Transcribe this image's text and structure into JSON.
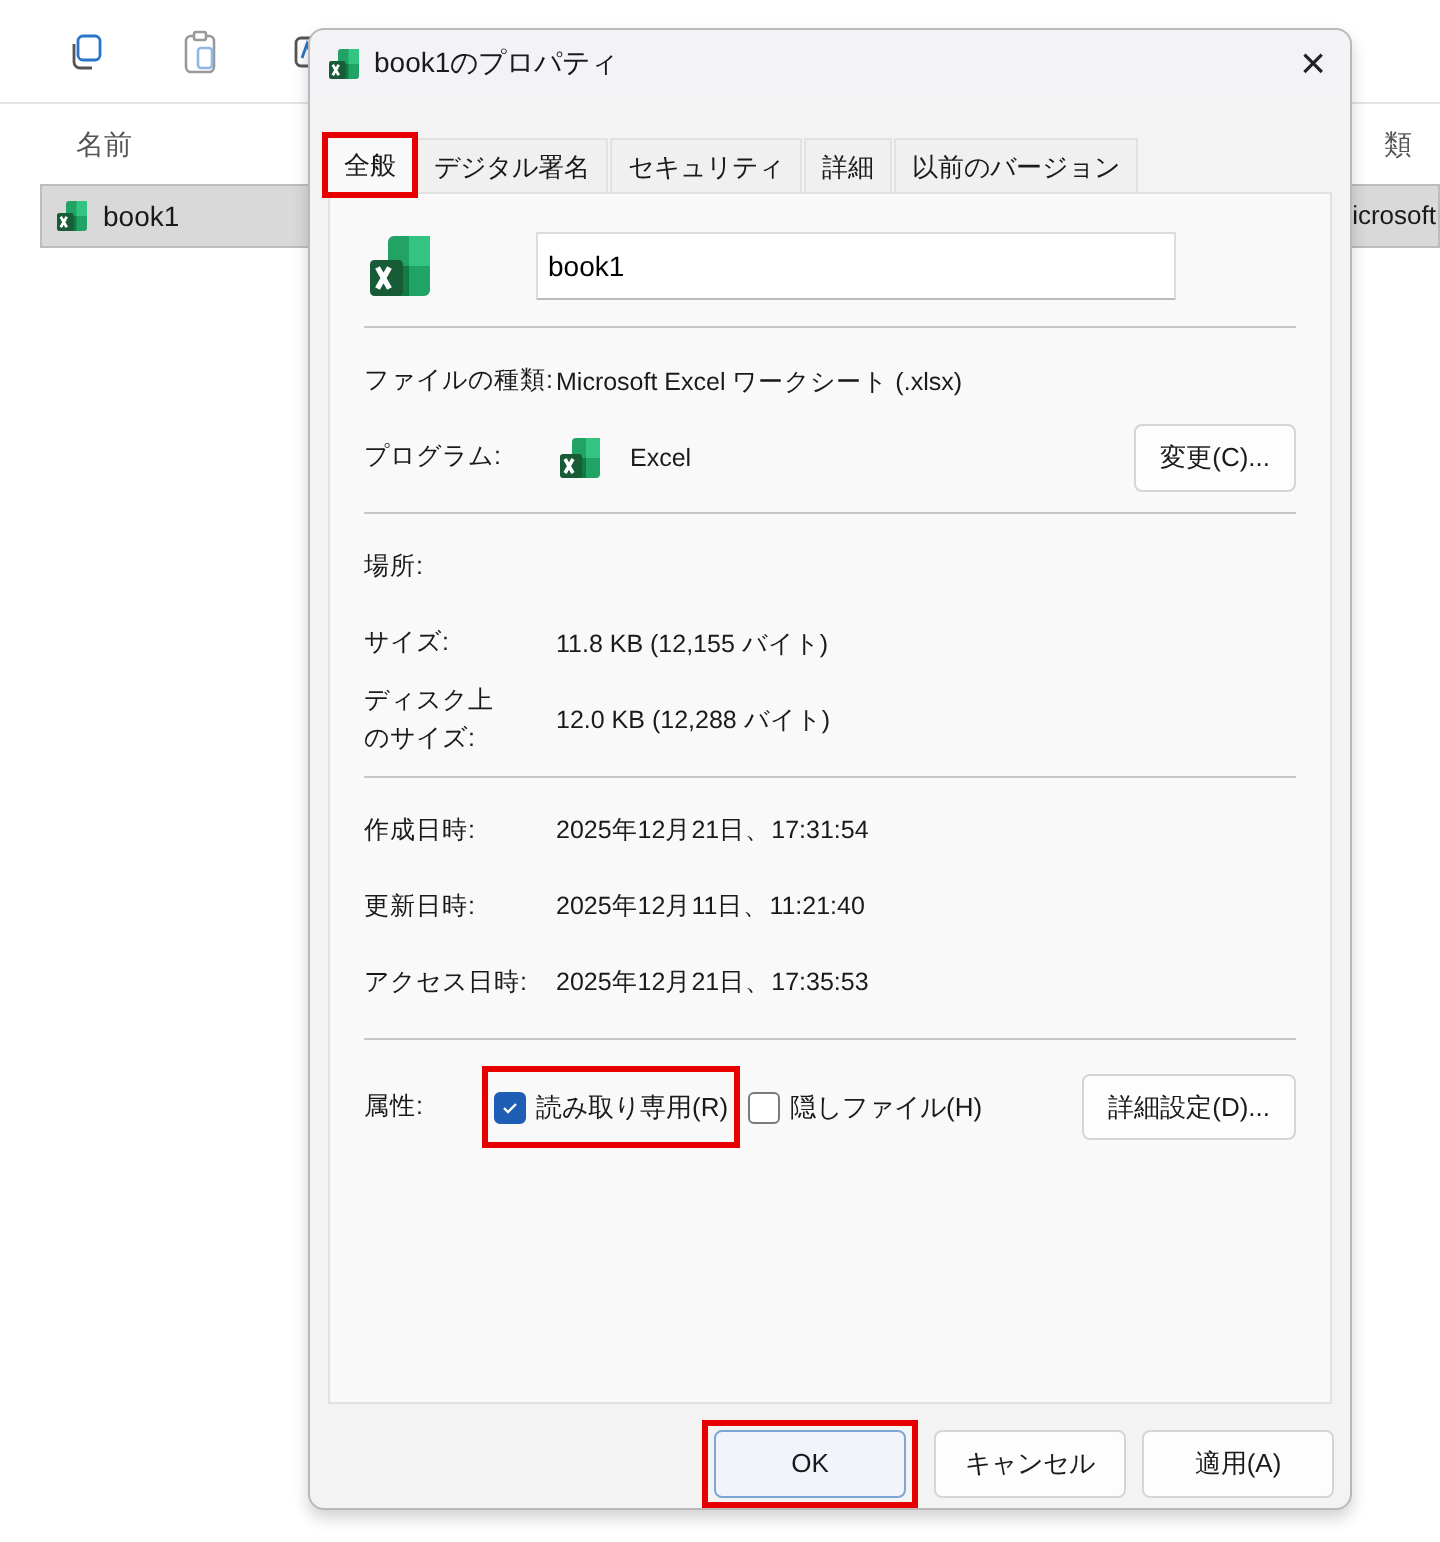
{
  "explorer": {
    "columns": [
      "名前",
      "類"
    ],
    "rows": [
      {
        "name": "book1",
        "type": "icrosoft",
        "selected": true
      }
    ]
  },
  "dialog": {
    "title": "book1のプロパティ",
    "close": "×",
    "tabs": [
      {
        "label": "全般",
        "selected": true,
        "highlighted": true
      },
      {
        "label": "デジタル署名",
        "selected": false,
        "highlighted": false
      },
      {
        "label": "セキュリティ",
        "selected": false,
        "highlighted": false
      },
      {
        "label": "詳細",
        "selected": false,
        "highlighted": false
      },
      {
        "label": "以前のバージョン",
        "selected": false,
        "highlighted": false
      }
    ],
    "file_name": "book1",
    "sections": [
      [
        {
          "label": "ファイルの種類:",
          "value": "Microsoft Excel ワークシート (.xlsx)"
        },
        {
          "label": "プログラム:",
          "value": "Excel",
          "kind": "program",
          "button": "変更(C)..."
        }
      ],
      [
        {
          "label": "場所:"
        },
        {
          "label": "サイズ:",
          "value": "11.8 KB (12,155 バイト)"
        },
        {
          "label_lines": [
            "ディスク上",
            "のサイズ:"
          ],
          "value": "12.0 KB (12,288 バイト)"
        }
      ],
      [
        {
          "label": "作成日時:",
          "value": "2025年12月21日、17:31:54"
        },
        {
          "label": "更新日時:",
          "value": "2025年12月11日、11:21:40"
        },
        {
          "label": "アクセス日時:",
          "value": "2025年12月21日、17:35:53"
        }
      ]
    ],
    "attributes": {
      "label": "属性:",
      "checkboxes": [
        {
          "label": "読み取り専用(R)",
          "checked": true,
          "highlighted": true
        },
        {
          "label": "隠しファイル(H)",
          "checked": false,
          "highlighted": false
        }
      ],
      "button": "詳細設定(D)..."
    },
    "buttons": [
      {
        "label": "OK",
        "default": true,
        "highlighted": true
      },
      {
        "label": "キャンセル",
        "default": false,
        "highlighted": false
      },
      {
        "label": "適用(A)",
        "default": false,
        "highlighted": false
      }
    ]
  }
}
